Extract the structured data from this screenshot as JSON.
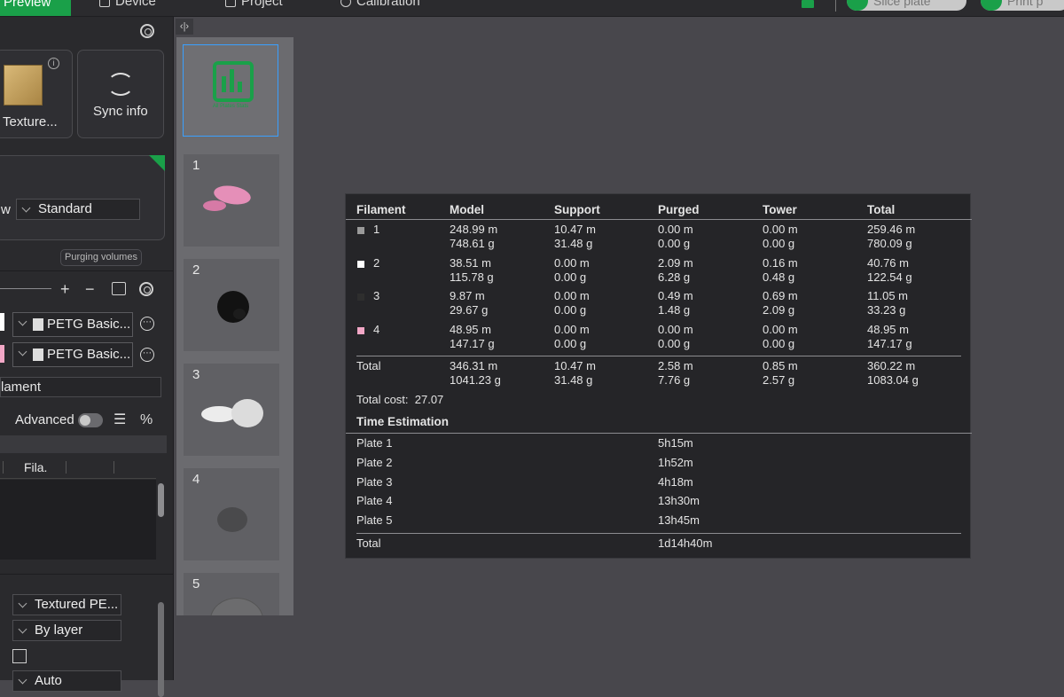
{
  "topbar": {
    "tabs": [
      "Preview",
      "Device",
      "Project",
      "Calibration"
    ],
    "slice_label": "Slice plate",
    "print_label": "Print p"
  },
  "left": {
    "plate_type_label": "Texture...",
    "sync_label": "Sync info",
    "flow_label": "w",
    "flow_value": "Standard",
    "purging_label": "Purging volumes",
    "filaments": [
      {
        "name": "PETG Basic...",
        "color": "#ffffff"
      },
      {
        "name": "PETG Basic...",
        "color": "#f2a7c6"
      }
    ],
    "filament_header": "lament",
    "advanced_label": "Advanced",
    "table_col": "Fila.",
    "dropdowns": [
      "Textured PE...",
      "By layer"
    ],
    "bottom_partial": "Auto"
  },
  "thumbs": {
    "all_label": "All Plates Stats",
    "plates": [
      "1",
      "2",
      "3",
      "4",
      "5"
    ]
  },
  "stats": {
    "headers": [
      "Filament",
      "Model",
      "Support",
      "Purged",
      "Tower",
      "Total"
    ],
    "rows": [
      {
        "id": "1",
        "color": "#9a9a9a",
        "model": "248.99 m\n748.61 g",
        "support": "10.47 m\n31.48 g",
        "purged": "0.00 m\n0.00 g",
        "tower": "0.00 m\n0.00 g",
        "total": "259.46 m\n780.09 g"
      },
      {
        "id": "2",
        "color": "#ffffff",
        "model": "38.51 m\n115.78 g",
        "support": "0.00 m\n0.00 g",
        "purged": "2.09 m\n6.28 g",
        "tower": "0.16 m\n0.48 g",
        "total": "40.76 m\n122.54 g"
      },
      {
        "id": "3",
        "color": "#2e2e2e",
        "model": "9.87 m\n29.67 g",
        "support": "0.00 m\n0.00 g",
        "purged": "0.49 m\n1.48 g",
        "tower": "0.69 m\n2.09 g",
        "total": "11.05 m\n33.23 g"
      },
      {
        "id": "4",
        "color": "#f2a7c6",
        "model": "48.95 m\n147.17 g",
        "support": "0.00 m\n0.00 g",
        "purged": "0.00 m\n0.00 g",
        "tower": "0.00 m\n0.00 g",
        "total": "48.95 m\n147.17 g"
      }
    ],
    "total_row": {
      "label": "Total",
      "model": "346.31 m\n1041.23 g",
      "support": "10.47 m\n31.48 g",
      "purged": "2.58 m\n7.76 g",
      "tower": "0.85 m\n2.57 g",
      "total": "360.22 m\n1083.04 g"
    },
    "total_cost": "Total cost:  27.07",
    "time_title": "Time Estimation",
    "plates": [
      {
        "label": "Plate 1",
        "time": "5h15m"
      },
      {
        "label": "Plate 2",
        "time": "1h52m"
      },
      {
        "label": "Plate 3",
        "time": "4h18m"
      },
      {
        "label": "Plate 4",
        "time": "13h30m"
      },
      {
        "label": "Plate 5",
        "time": "13h45m"
      }
    ],
    "time_total_label": "Total",
    "time_total": "1d14h40m"
  }
}
